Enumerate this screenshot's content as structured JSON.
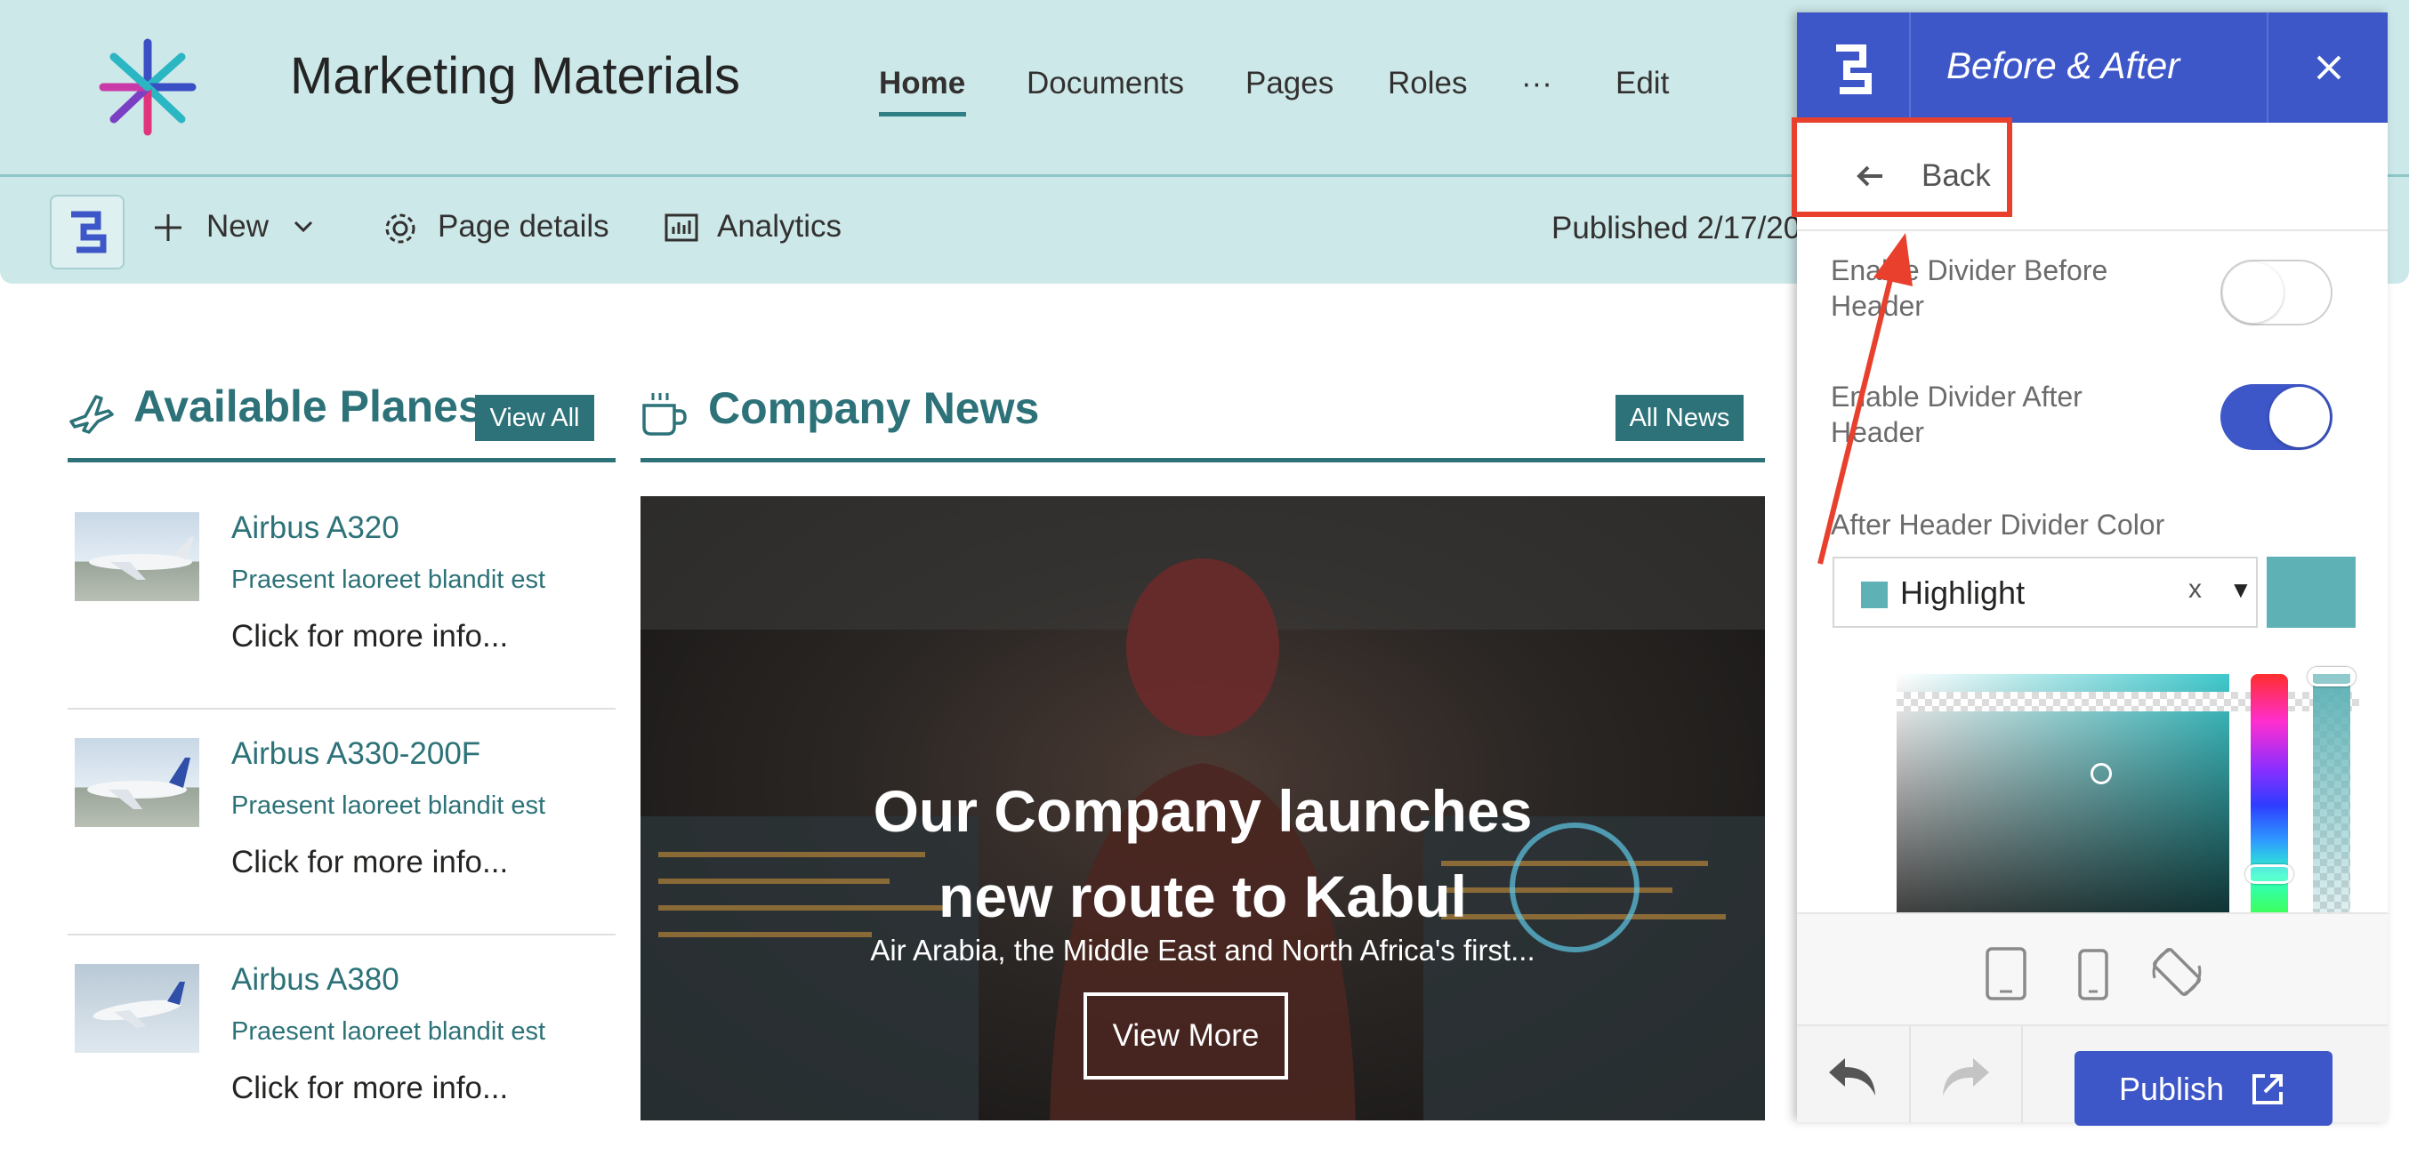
{
  "site": {
    "title": "Marketing Materials",
    "nav": [
      {
        "label": "Home",
        "active": true
      },
      {
        "label": "Documents",
        "active": false
      },
      {
        "label": "Pages",
        "active": false
      },
      {
        "label": "Roles",
        "active": false
      },
      {
        "label": "···",
        "active": false
      },
      {
        "label": "Edit",
        "active": false
      }
    ]
  },
  "command_bar": {
    "new_label": "New",
    "page_details_label": "Page details",
    "analytics_label": "Analytics",
    "published_text": "Published 2/17/20"
  },
  "planes": {
    "title": "Available Planes",
    "view_all_label": "View All",
    "items": [
      {
        "name": "Airbus A320",
        "desc": "Praesent laoreet blandit est",
        "more": "Click for more info..."
      },
      {
        "name": "Airbus A330-200F",
        "desc": "Praesent laoreet blandit est",
        "more": "Click for more info..."
      },
      {
        "name": "Airbus A380",
        "desc": "Praesent laoreet blandit est",
        "more": "Click for more info..."
      }
    ]
  },
  "news": {
    "title": "Company News",
    "all_news_label": "All News",
    "hero_title_line1": "Our Company launches",
    "hero_title_line2": "new route to Kabul",
    "hero_subtitle": "Air Arabia, the Middle East and North Africa's first...",
    "view_more_label": "View More"
  },
  "panel": {
    "title": "Before & After",
    "back_label": "Back",
    "options": [
      {
        "label": "Enable Divider Before Header",
        "enabled": false
      },
      {
        "label": "Enable Divider After Header",
        "enabled": true
      }
    ],
    "color_label": "After Header Divider Color",
    "color_value": "Highlight",
    "color_hex": "#5eb2b6",
    "clear_label": "x",
    "dropdown_arrow": "▼",
    "publish_label": "Publish"
  },
  "colors": {
    "theme_teal": "#2c7278",
    "header_bg": "#cde8e9",
    "panel_blue": "#3d56c8",
    "annotation_red": "#e8402d"
  }
}
